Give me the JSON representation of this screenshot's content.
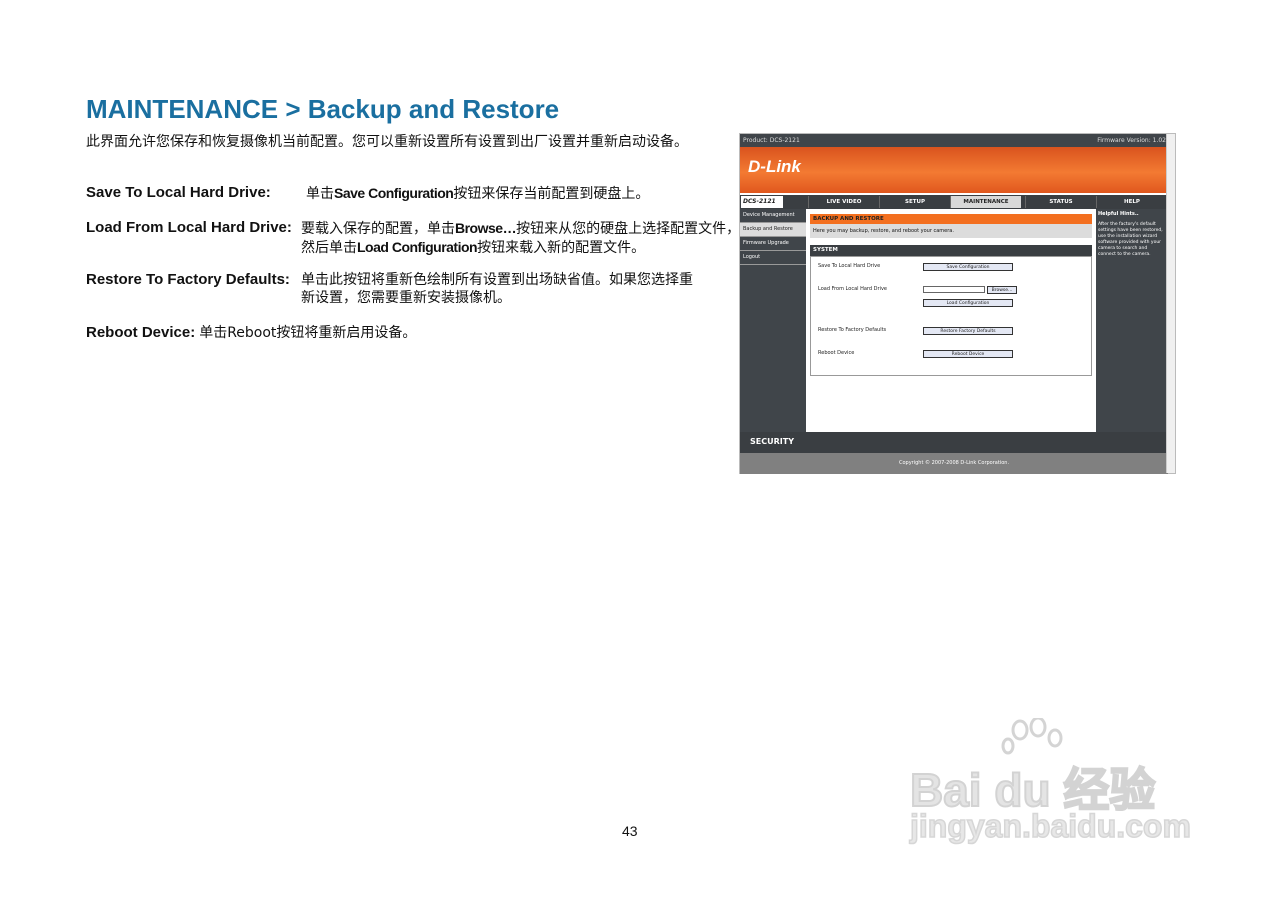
{
  "doc": {
    "title": "MAINTENANCE > Backup and Restore",
    "intro": "此界面允许您保存和恢复摄像机当前配置。您可以重新设置所有设置到出厂设置并重新启动设备。",
    "items": [
      {
        "label": "Save To Local Hard Drive:",
        "pre": "单击",
        "kw": "Save Configuration",
        "post": "按钮来保存当前配置到硬盘上。"
      },
      {
        "label": "Load From Local Hard Drive:",
        "pre": "要载入保存的配置，单击",
        "kw": "Browse…",
        "post": "按钮来从您的硬盘上选择配置文件，",
        "line2_pre": "然后单击",
        "line2_kw": "Load Configuration",
        "line2_post": "按钮来载入新的配置文件。"
      },
      {
        "label": "Restore To Factory Defaults:",
        "line1": "单击此按钮将重新色绘制所有设置到出场缺省值。如果您选择重",
        "line2": "新设置，您需要重新安装摄像机。"
      },
      {
        "label": "Reboot Device:",
        "pre": "单击",
        "kw": "Reboot",
        "post": "按钮将重新启用设备。"
      }
    ],
    "page_number": "43"
  },
  "screenshot": {
    "product": "Product: DCS-2121",
    "firmware": "Firmware Version: 1.02",
    "logo": "D-Link",
    "model": "DCS-2121",
    "tabs": [
      "LIVE VIDEO",
      "SETUP",
      "MAINTENANCE",
      "STATUS",
      "HELP"
    ],
    "left_nav": [
      "Device Management",
      "Backup and Restore",
      "Firmware Upgrade",
      "Logout"
    ],
    "section_title": "BACKUP AND RESTORE",
    "section_desc": "Here you may backup, restore, and reboot your camera.",
    "system_title": "SYSTEM",
    "rows": {
      "save_label": "Save To Local Hard Drive",
      "save_btn": "Save Configuration",
      "load_label": "Load From Local Hard Drive",
      "browse_btn": "Browse...",
      "load_btn": "Load Configuration",
      "restore_label": "Restore To Factory Defaults",
      "restore_btn": "Restore Factory Defaults",
      "reboot_label": "Reboot Device",
      "reboot_btn": "Reboot Device"
    },
    "help_title": "Helpful Hints..",
    "help_text": "After the factory's default settings have been restored, use the installation wizard software provided with your camera to search and connect to the camera.",
    "security": "SECURITY",
    "copyright": "Copyright © 2007-2008 D-Link Corporation."
  },
  "watermark": {
    "brand": "Bai du 经验",
    "url": "jingyan.baidu.com"
  }
}
